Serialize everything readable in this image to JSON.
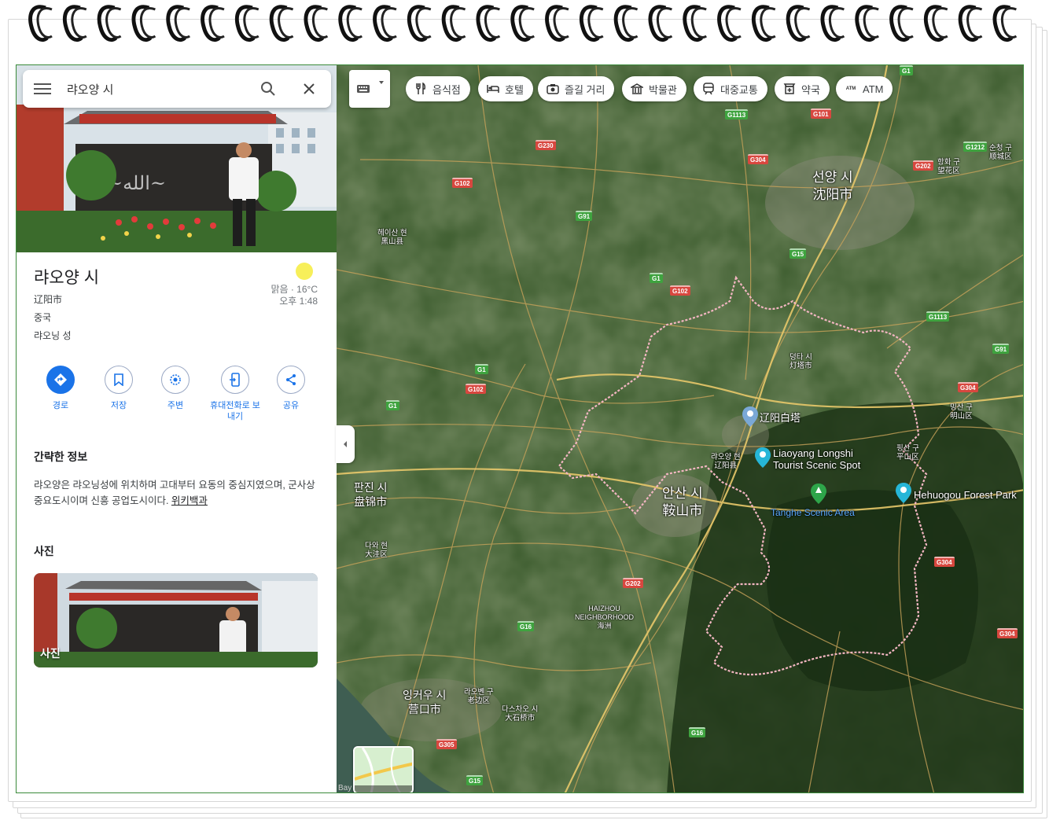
{
  "search": {
    "query": "랴오양 시"
  },
  "place": {
    "title": "랴오양 시",
    "native_name": "辽阳市",
    "country": "중국",
    "province": "랴오닝 성",
    "weather": "맑음 · 16°C",
    "time": "오후 1:48"
  },
  "actions": [
    {
      "label": "경로",
      "icon": "directions-icon"
    },
    {
      "label": "저장",
      "icon": "bookmark-icon"
    },
    {
      "label": "주변",
      "icon": "nearby-icon"
    },
    {
      "label": "휴대전화로 보내기",
      "icon": "send-to-phone-icon"
    },
    {
      "label": "공유",
      "icon": "share-icon"
    }
  ],
  "summary": {
    "title": "간략한 정보",
    "text": "랴오양은 랴오닝성에 위치하며 고대부터 요동의 중심지였으며, 군사상 중요도시이며 신흥 공업도시이다. ",
    "link": "위키백과"
  },
  "photos": {
    "title": "사진",
    "card_label": "사진"
  },
  "chips": [
    {
      "label": "음식점",
      "icon": "restaurant-icon"
    },
    {
      "label": "호텔",
      "icon": "hotel-icon"
    },
    {
      "label": "즐길 거리",
      "icon": "camera-icon"
    },
    {
      "label": "박물관",
      "icon": "museum-icon"
    },
    {
      "label": "대중교통",
      "icon": "transit-icon"
    },
    {
      "label": "약국",
      "icon": "pharmacy-icon"
    },
    {
      "label": "ATM",
      "icon": "atm-icon"
    }
  ],
  "map_labels": {
    "shenyang_ko": "선양 시",
    "shenyang_zh": "沈阳市",
    "anshan_ko": "안산 시",
    "anshan_zh": "鞍山市",
    "panjin_ko": "판진 시",
    "panjin_zh": "盘锦市",
    "yingkou_ko": "잉커우 시",
    "yingkou_zh": "营口市",
    "dengta": "덩타 시\n灯塔市",
    "liaoyang_county": "랴오양 현\n辽阳县",
    "heishan": "헤이산 현\n黑山县",
    "dawa": "다와 현\n大洼区",
    "laobian": "라오볜 구\n老边区",
    "dashiqiao": "다스차오 시\n大石桥市",
    "haizhou": "HAIZHOU\nNEIGHBORHOOD\n海洲",
    "hunnan": "항화 구\n望花区",
    "shenfu": "순청 구\n顺城区",
    "mingshan": "밍산 구\n明山区",
    "pingshan": "핑산 구\n平山区",
    "bay": "Bay",
    "poi_baita": "辽阳白塔",
    "poi_longshi": "Liaoyang Longshi\nTourist Scenic Spot",
    "poi_tanghe": "Tanghe Scenic Area",
    "poi_hehuogou": "Hehuogou Forest Park"
  },
  "roads": [
    "G1",
    "G1113",
    "G101",
    "G230",
    "G304",
    "G1212",
    "G202",
    "G102",
    "G91",
    "G15",
    "G1113",
    "G91",
    "G304",
    "G16",
    "G202",
    "G305",
    "G15",
    "G16",
    "G304",
    "G304",
    "G1",
    "G102",
    "G1",
    "G102",
    "G1"
  ],
  "layers_label": "레이어"
}
